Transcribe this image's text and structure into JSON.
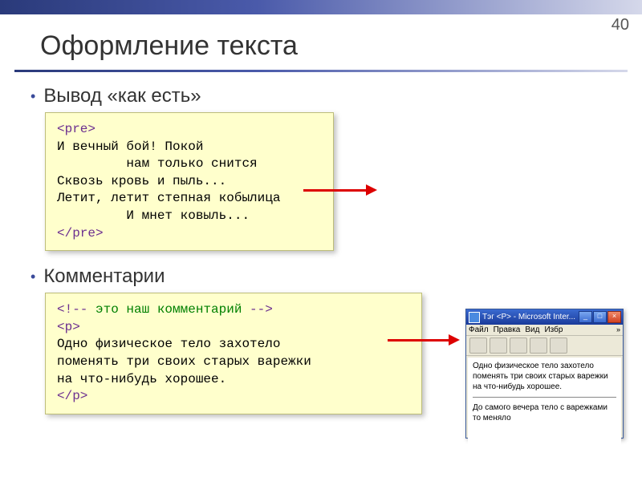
{
  "page_number": "40",
  "title": "Оформление текста",
  "bullets": {
    "b1": "Вывод «как есть»",
    "b2": "Комментарии"
  },
  "pre_code": {
    "open": "<pre>",
    "line1": "И вечный бой! Покой",
    "line2": "         нам только снится",
    "line3": "Сквозь кровь и пыль...",
    "line4": "Летит, летит степная кобылица",
    "line5": "         И мнет ковыль...",
    "close": "</pre>"
  },
  "comment_code": {
    "open_delim": "<!--",
    "comment_text": " это наш комментарий ",
    "close_delim": "-->",
    "p_open": "<p>",
    "body1": "Одно физическое тело захотело",
    "body2": "поменять три своих старых варежки",
    "body3": "на что-нибудь хорошее.",
    "p_close": "</p>"
  },
  "browser": {
    "title": "Тэг <P> - Microsoft Inter...",
    "menu": {
      "file": "Файл",
      "edit": "Правка",
      "view": "Вид",
      "fav": "Избр"
    },
    "win_min": "_",
    "win_max": "□",
    "win_close": "×",
    "chevron": "»",
    "body_p1": "Одно физическое тело захотело поменять три своих старых варежки на что-нибудь хорошее.",
    "body_p2": "До самого вечера тело с варежками то меняло"
  }
}
